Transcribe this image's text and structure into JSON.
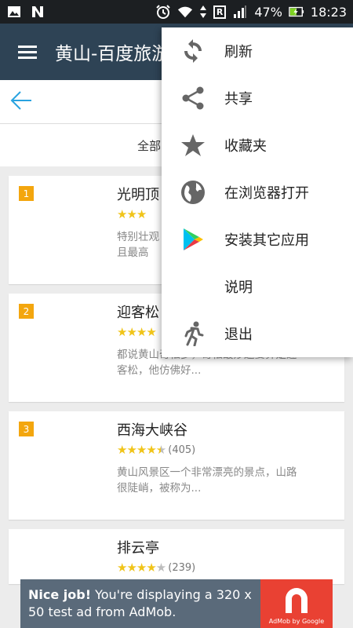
{
  "statusbar": {
    "battery": "47%",
    "time": "18:23",
    "carrier_badge": "R"
  },
  "appbar": {
    "title": "黄山-百度旅游"
  },
  "toolbar": {
    "back_label": ""
  },
  "filter": {
    "label": "全部"
  },
  "cards": [
    {
      "rank": "1",
      "title": "光明顶",
      "stars": 3,
      "count": "",
      "desc1": "特别壮观",
      "desc2": "且最高"
    },
    {
      "rank": "2",
      "title": "迎客松",
      "stars": 4,
      "count": "",
      "desc1": "都说黄山奇松多，奇松最妙还要算是迎",
      "desc2": "客松，他仿佛好..."
    },
    {
      "rank": "3",
      "title": "西海大峡谷",
      "stars": 4.5,
      "count": "(405)",
      "desc1": "黄山风景区一个非常漂亮的景点，山路",
      "desc2": "很陡峭，被称为..."
    },
    {
      "rank": "",
      "title": "排云亭",
      "stars": 4,
      "count": "(239)",
      "desc1": "",
      "desc2": ""
    }
  ],
  "admob": {
    "lead": "Nice job!",
    "text": " You're displaying a 320 x 50 test ad from AdMob.",
    "brand": "AdMob by Google"
  },
  "menu": {
    "items": [
      {
        "label": "刷新",
        "icon": "refresh-icon"
      },
      {
        "label": "共享",
        "icon": "share-icon"
      },
      {
        "label": "收藏夹",
        "icon": "star-icon"
      },
      {
        "label": "在浏览器打开",
        "icon": "globe-icon"
      },
      {
        "label": "安装其它应用",
        "icon": "play-store-icon"
      },
      {
        "label": "说明",
        "icon": ""
      },
      {
        "label": "退出",
        "icon": "exit-runner-icon"
      }
    ]
  },
  "colors": {
    "appbar": "#2e4355",
    "accent": "#29a3e0",
    "rank_badge": "#f3a60e",
    "star": "#f0c419"
  }
}
